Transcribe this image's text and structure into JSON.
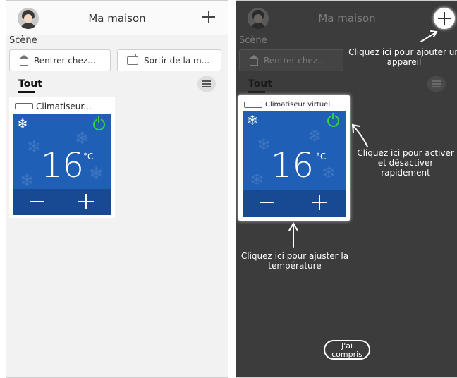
{
  "header": {
    "title": "Ma maison"
  },
  "scene": {
    "label": "Scène",
    "buttons": [
      {
        "label": "Rentrer chez...",
        "icon": "home-icon"
      },
      {
        "label": "Sortir de la m...",
        "icon": "suitcase-icon"
      }
    ]
  },
  "tabs": {
    "active": "Tout"
  },
  "device_left": {
    "name": "Climatiseur...",
    "temperature": "16",
    "unit": "°C",
    "mode_icon": "snowflake-icon",
    "power_icon": "power-icon"
  },
  "device_right": {
    "name": "Climatiseur virtuel",
    "temperature": "16",
    "unit": "°C"
  },
  "overlay": {
    "hint_add": "Cliquez ici pour ajouter un appareil",
    "hint_power": "Cliquez ici pour activer et désactiver rapidement",
    "hint_temp": "Cliquez ici pour ajuster la température",
    "ok_button": "J'ai compris"
  },
  "colors": {
    "panel_blue": "#1f5fb6",
    "control_blue": "#174a93",
    "power_green": "#34d14b",
    "overlay_dark": "#3c3c3c"
  }
}
